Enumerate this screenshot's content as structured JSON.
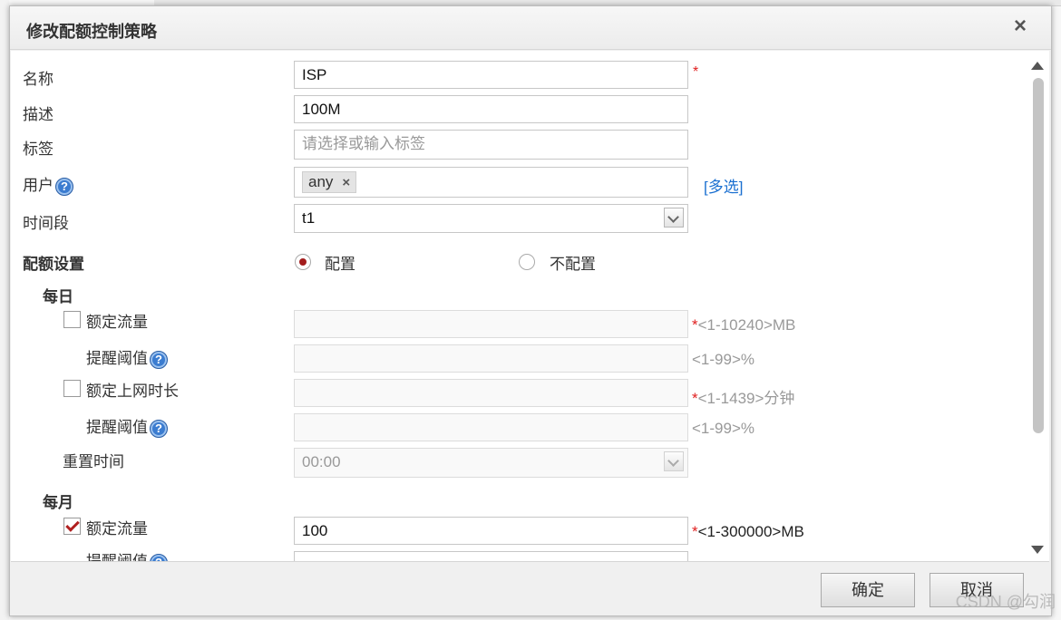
{
  "dialog": {
    "title": "修改配额控制策略",
    "close_icon": "close-icon"
  },
  "form": {
    "name": {
      "label": "名称",
      "value": "ISP",
      "required_mark": "*"
    },
    "description": {
      "label": "描述",
      "value": "100M"
    },
    "tags": {
      "label": "标签",
      "placeholder": "请选择或输入标签"
    },
    "user": {
      "label": "用户",
      "help": "?",
      "tag": "any",
      "tag_remove": "×",
      "multi_select": "[多选]"
    },
    "time_period": {
      "label": "时间段",
      "value": "t1"
    },
    "quota_settings": {
      "label": "配额设置",
      "option_on": "配置",
      "option_off": "不配置",
      "selected": "配置"
    },
    "daily": {
      "section": "每日",
      "traffic": {
        "label": "额定流量",
        "checked": false,
        "star": "*",
        "hint": "<1-10240>MB"
      },
      "traffic_alert": {
        "label": "提醒阈值",
        "help": "?",
        "hint": "<1-99>%"
      },
      "online_time": {
        "label": "额定上网时长",
        "checked": false,
        "star": "*",
        "hint": "<1-1439>分钟"
      },
      "online_alert": {
        "label": "提醒阈值",
        "help": "?",
        "hint": "<1-99>%"
      },
      "reset_time": {
        "label": "重置时间",
        "value": "00:00"
      }
    },
    "monthly": {
      "section": "每月",
      "traffic": {
        "label": "额定流量",
        "checked": true,
        "value": "100",
        "star": "*",
        "hint": "<1-300000>MB"
      },
      "traffic_alert": {
        "label": "提醒阈值",
        "help": "?"
      }
    }
  },
  "footer": {
    "ok": "确定",
    "cancel": "取消"
  },
  "watermark": "CSDN @勾润",
  "colors": {
    "required": "#e02020",
    "link": "#1a6fd0",
    "radio_selected": "#a31d1d",
    "help_icon": "#3b7cd0"
  }
}
